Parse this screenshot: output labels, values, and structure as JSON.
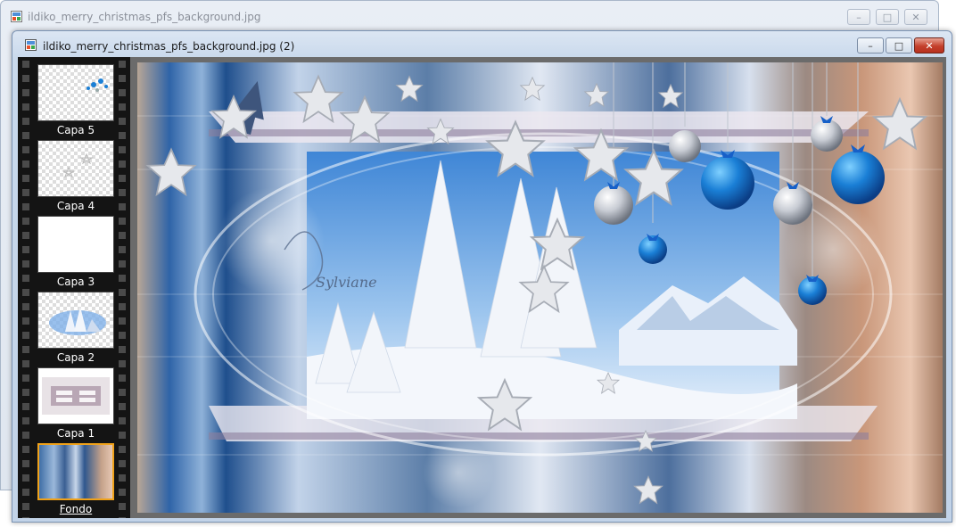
{
  "background_window": {
    "title": "ildiko_merry_christmas_pfs_background.jpg",
    "buttons": {
      "minimize": "–",
      "maximize": "□",
      "close": "✕"
    }
  },
  "main_window": {
    "title": "ildiko_merry_christmas_pfs_background.jpg (2)",
    "buttons": {
      "minimize": "–",
      "maximize": "□",
      "close": "✕"
    }
  },
  "layers": [
    {
      "label": "Capa 5"
    },
    {
      "label": "Capa 4"
    },
    {
      "label": "Capa 3"
    },
    {
      "label": "Capa 2"
    },
    {
      "label": "Capa 1"
    },
    {
      "label": "Fondo"
    }
  ],
  "canvas": {
    "signature": "Sylviane",
    "colors": {
      "sky_blue": "#5e9ad8",
      "ornament_blue": "#1a7fd6",
      "copper": "#c79a7a",
      "silver": "#c8ccd4"
    }
  }
}
